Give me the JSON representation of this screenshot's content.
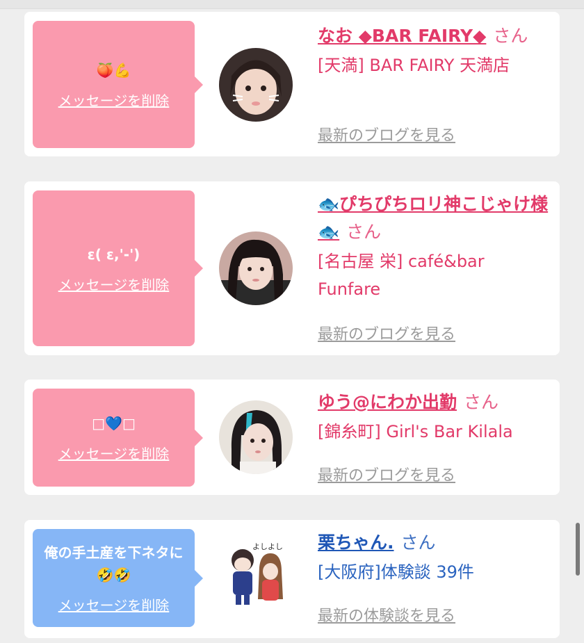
{
  "cards": [
    {
      "message": "🍑💪",
      "delete_label": "メッセージを削除",
      "name": "なお ◆BAR FAIRY◆",
      "san": "さん",
      "shop": "[天満] BAR FAIRY 天満店",
      "blog_link": "最新のブログを見る"
    },
    {
      "message": "ε( ε,'-')",
      "delete_label": "メッセージを削除",
      "name": "🐟ぴちぴちロリ神こじゃけ様🐟",
      "san": "さん",
      "shop": "[名古屋 栄] café&bar Funfare",
      "blog_link": "最新のブログを見る"
    },
    {
      "message": "□💙□",
      "delete_label": "メッセージを削除",
      "name": "ゆう@にわか出勤",
      "san": "さん",
      "shop": "[錦糸町] Girl's Bar Kilala",
      "blog_link": "最新のブログを見る"
    },
    {
      "message": "俺の手土産を下ネタに🤣🤣",
      "delete_label": "メッセージを削除",
      "name": "栗ちゃん.",
      "san": "さん",
      "shop": "[大阪府]体験談 39件",
      "blog_link": "最新の体験談を見る",
      "sticker_text": "よしよし"
    }
  ],
  "colors": {
    "pink_bubble": "#fa9aae",
    "blue_bubble": "#86b6f6",
    "pink_text": "#e23a69",
    "blue_text": "#1f57b6"
  }
}
